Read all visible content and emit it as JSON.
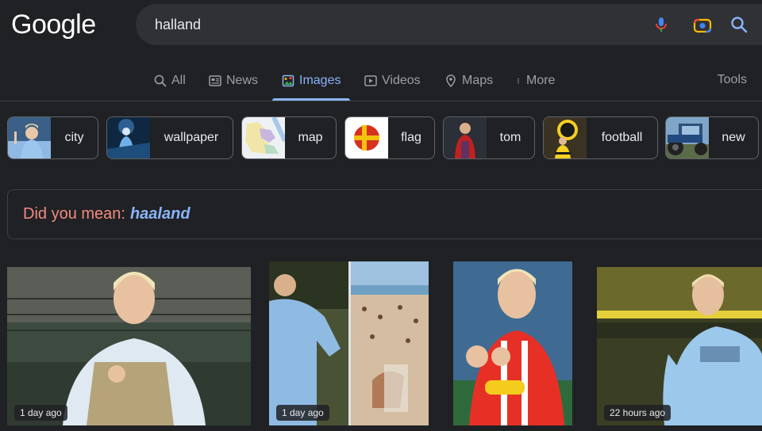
{
  "logo": "Google",
  "search": {
    "query": "halland"
  },
  "tabs": [
    {
      "label": "All",
      "icon": "search-icon"
    },
    {
      "label": "News",
      "icon": "news-icon"
    },
    {
      "label": "Images",
      "icon": "images-icon",
      "active": true
    },
    {
      "label": "Videos",
      "icon": "video-icon"
    },
    {
      "label": "Maps",
      "icon": "map-pin-icon"
    },
    {
      "label": "More",
      "icon": "more-vert-icon"
    }
  ],
  "tools_label": "Tools",
  "chips": [
    {
      "label": "city"
    },
    {
      "label": "wallpaper"
    },
    {
      "label": "map"
    },
    {
      "label": "flag"
    },
    {
      "label": "tom"
    },
    {
      "label": "football"
    },
    {
      "label": "new"
    }
  ],
  "did_you_mean": {
    "lead": "Did you mean:",
    "suggestion": "haaland"
  },
  "results": [
    {
      "age": "1 day ago"
    },
    {
      "age": "1 day ago"
    },
    {
      "age": ""
    },
    {
      "age": "22 hours ago"
    }
  ],
  "colors": {
    "accent": "#8ab4f8",
    "did_you_mean": "#f28b82",
    "background": "#202124"
  }
}
